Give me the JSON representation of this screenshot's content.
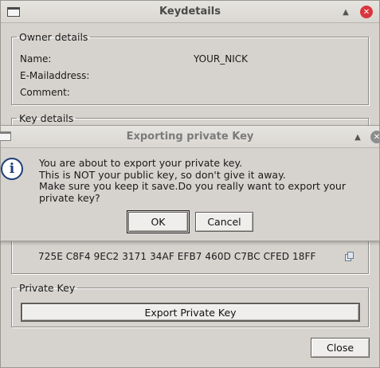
{
  "main_window": {
    "title": "Keydetails",
    "owner_details": {
      "legend": "Owner details",
      "name_label": "Name:",
      "name_value": "YOUR_NICK",
      "email_label": "E-Mailaddress:",
      "comment_label": "Comment:"
    },
    "key_details": {
      "legend": "Key details",
      "fingerprint": "725E C8F4 9EC2 3171 34AF EFB7 460D C7BC CFED 18FF"
    },
    "private_key": {
      "legend": "Private Key",
      "export_button": "Export Private Key"
    },
    "close_button": "Close"
  },
  "dialog": {
    "title": "Exporting private Key",
    "message": "You are about to export your private key.\nThis is NOT your public key, so don't give it away.\nMake sure you keep it save.Do you really want to export your private key?",
    "ok_button": "OK",
    "cancel_button": "Cancel"
  },
  "icons": {
    "minimize": "minimize-icon",
    "close": "close-icon",
    "info": "info-icon",
    "copy": "copy-icon"
  },
  "colors": {
    "window_bg": "#d6d3ce",
    "close_button_active": "#d9363e",
    "info_icon": "#1f3d7a"
  }
}
